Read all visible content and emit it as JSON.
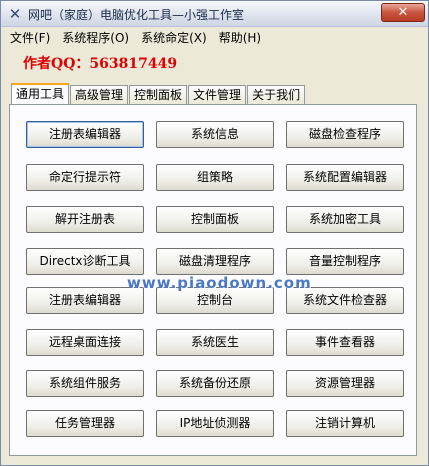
{
  "window": {
    "title": "网吧（家庭）电脑优化工具—小强工作室",
    "close_glyph": "✕",
    "icon_glyph": "✕"
  },
  "menu": [
    {
      "label": "文件(F)"
    },
    {
      "label": "系统程序(O)"
    },
    {
      "label": "系统命定(X)"
    },
    {
      "label": "帮助(H)"
    }
  ],
  "author": "作者QQ：563817449",
  "tabs": [
    {
      "label": "通用工具",
      "active": true
    },
    {
      "label": "高级管理"
    },
    {
      "label": "控制面板"
    },
    {
      "label": "文件管理"
    },
    {
      "label": "关于我们"
    }
  ],
  "buttons": [
    [
      "注册表编辑器",
      "系统信息",
      "磁盘检查程序"
    ],
    [
      "命定行提示符",
      "组策略",
      "系统配置编辑器"
    ],
    [
      "解开注册表",
      "控制面板",
      "系统加密工具"
    ],
    [
      "Directx诊断工具",
      "磁盘清理程序",
      "音量控制程序"
    ],
    [
      "注册表编辑器",
      "控制台",
      "系统文件检查器"
    ],
    [
      "远程桌面连接",
      "系统医生",
      "事件查看器"
    ],
    [
      "系统组件服务",
      "系统备份还原",
      "资源管理器"
    ],
    [
      "任务管理器",
      "IP地址侦测器",
      "注销计算机"
    ]
  ],
  "watermark": "www.piaodown.com"
}
